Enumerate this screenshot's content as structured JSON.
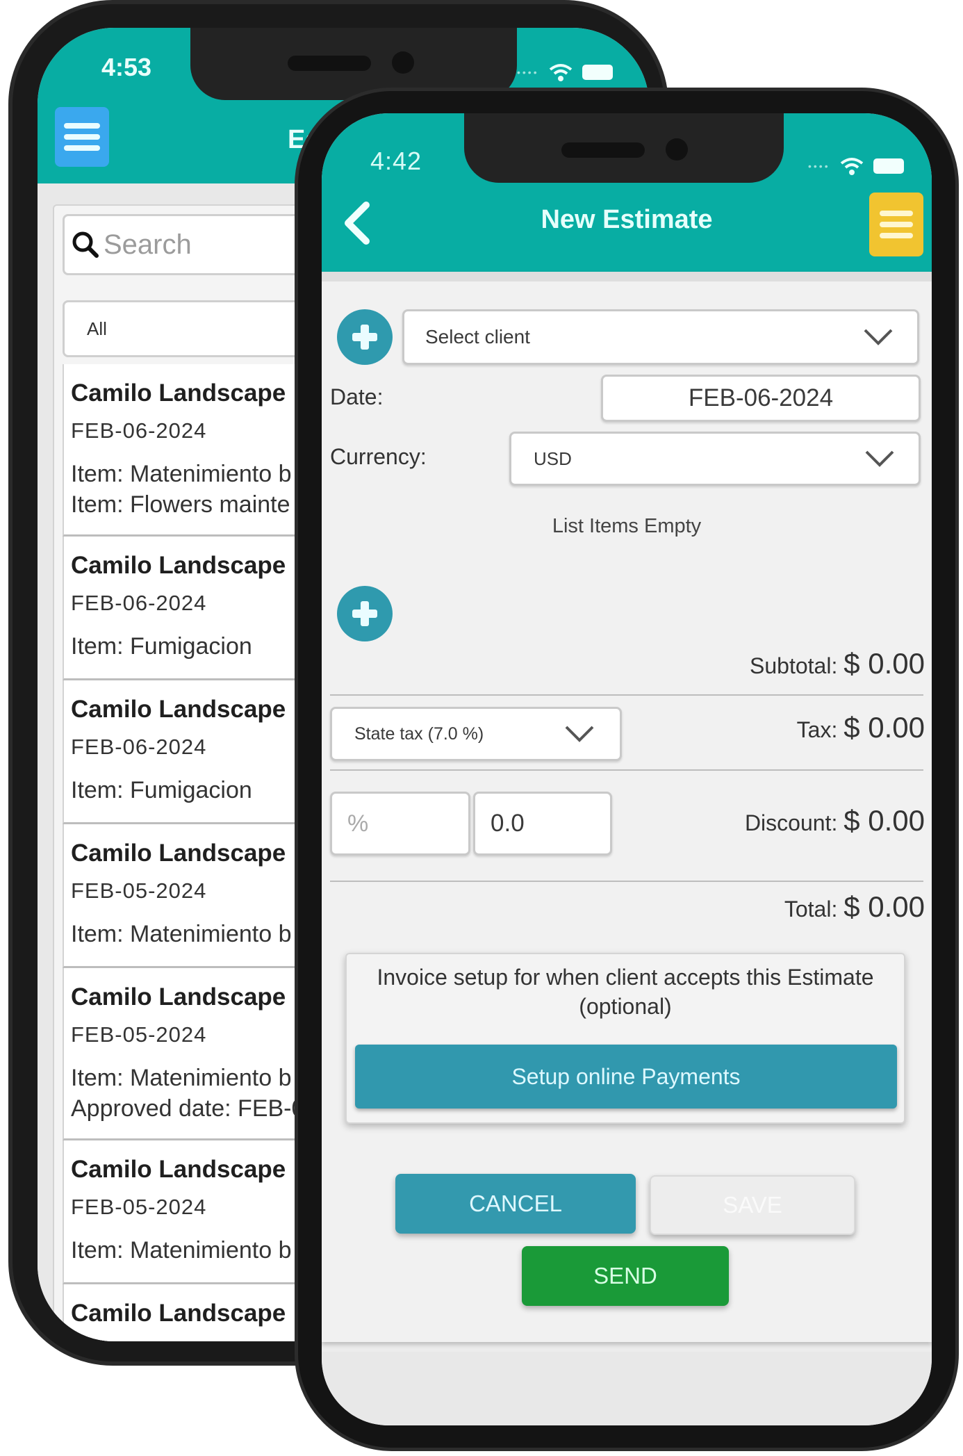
{
  "back_phone": {
    "status": {
      "time": "4:53"
    },
    "header": {
      "title": "Est",
      "menu_icon": "hamburger-menu-icon",
      "menu_color": "#3aa8ee"
    },
    "search": {
      "placeholder": "Search",
      "icon": "search-icon"
    },
    "filter": {
      "selected": "All"
    },
    "estimates": [
      {
        "client": "Camilo Landscape",
        "date": "FEB-06-2024",
        "lines": [
          "Item: Matenimiento b",
          "Item: Flowers mainte"
        ]
      },
      {
        "client": "Camilo Landscape",
        "date": "FEB-06-2024",
        "lines": [
          "Item: Fumigacion"
        ]
      },
      {
        "client": "Camilo Landscape",
        "date": "FEB-06-2024",
        "lines": [
          "Item: Fumigacion"
        ]
      },
      {
        "client": "Camilo Landscape",
        "date": "FEB-05-2024",
        "lines": [
          "Item: Matenimiento b"
        ]
      },
      {
        "client": "Camilo Landscape",
        "date": "FEB-05-2024",
        "lines": [
          "Item: Matenimiento b",
          "Approved date: FEB-0"
        ]
      },
      {
        "client": "Camilo Landscape",
        "date": "FEB-05-2024",
        "lines": [
          "Item: Matenimiento b"
        ]
      },
      {
        "client": "Camilo Landscape",
        "date": "",
        "lines": []
      }
    ]
  },
  "front_phone": {
    "status": {
      "time": "4:42"
    },
    "header": {
      "title": "New Estimate",
      "back_icon": "chevron-left-icon",
      "menu_icon": "hamburger-menu-icon",
      "menu_color": "#f1c430",
      "color": "#08ada3"
    },
    "form": {
      "client": {
        "placeholder": "Select client"
      },
      "date": {
        "label": "Date:",
        "value": "FEB-06-2024"
      },
      "currency": {
        "label": "Currency:",
        "value": "USD"
      },
      "items_empty": "List Items Empty",
      "subtotal": {
        "label": "Subtotal:",
        "value": "$ 0.00"
      },
      "tax": {
        "selected": "State tax (7.0 %)",
        "label": "Tax:",
        "value": "$ 0.00"
      },
      "discount": {
        "type": "%",
        "value": "0.0",
        "label": "Discount:",
        "amount": "$ 0.00"
      },
      "total": {
        "label": "Total:",
        "value": "$ 0.00"
      }
    },
    "invoice_setup": {
      "text": "Invoice setup for when client accepts this Estimate (optional)",
      "button": "Setup online Payments"
    },
    "actions": {
      "cancel": "CANCEL",
      "save": "SAVE",
      "send": "SEND"
    }
  }
}
